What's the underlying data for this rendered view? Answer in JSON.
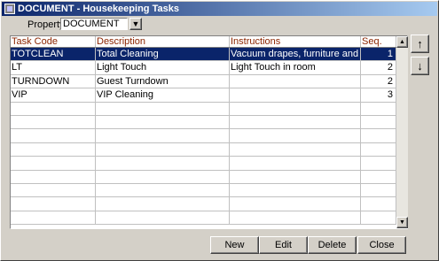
{
  "window": {
    "title": "DOCUMENT - Housekeeping Tasks"
  },
  "property": {
    "label": "Property",
    "value": "DOCUMENT"
  },
  "grid": {
    "columns": [
      "Task Code",
      "Description",
      "Instructions",
      "Seq."
    ],
    "rows": [
      {
        "code": "TOTCLEAN",
        "description": "Total Cleaning",
        "instructions": "Vacuum drapes, furniture and carpe",
        "seq": "1"
      },
      {
        "code": "LT",
        "description": "Light Touch",
        "instructions": "Light Touch in room",
        "seq": "2"
      },
      {
        "code": "TURNDOWN",
        "description": "Guest Turndown",
        "instructions": "",
        "seq": "2"
      },
      {
        "code": "VIP",
        "description": "VIP Cleaning",
        "instructions": "",
        "seq": "3"
      }
    ],
    "selected_row": 0,
    "empty_rows": 9
  },
  "side_buttons": {
    "up": "↑",
    "down": "↓"
  },
  "buttons": {
    "new": "New",
    "edit": "Edit",
    "delete": "Delete",
    "close": "Close"
  },
  "colors": {
    "selection": "#0a246a",
    "header_text": "#8b2500",
    "titlebar": "#0a246a"
  },
  "icons": [
    "app-icon",
    "dropdown-arrow-icon",
    "scroll-up-icon",
    "scroll-down-icon",
    "arrow-up-icon",
    "arrow-down-icon"
  ]
}
